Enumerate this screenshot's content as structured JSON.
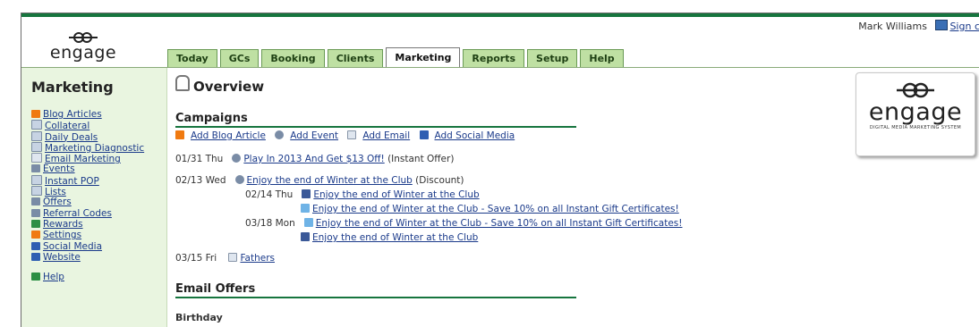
{
  "app": {
    "logo_text": "engage",
    "user_name": "Mark Williams",
    "sign_out": "Sign c"
  },
  "tabs": [
    {
      "label": "Today"
    },
    {
      "label": "GCs"
    },
    {
      "label": "Booking"
    },
    {
      "label": "Clients"
    },
    {
      "label": "Marketing",
      "active": true
    },
    {
      "label": "Reports"
    },
    {
      "label": "Setup"
    },
    {
      "label": "Help"
    }
  ],
  "sidebar": {
    "title": "Marketing",
    "items": [
      {
        "label": "Blog Articles",
        "icon": "rss-icon"
      },
      {
        "label": "Collateral",
        "icon": "collateral-icon"
      },
      {
        "label": "Daily Deals",
        "icon": "daily-deals-icon"
      },
      {
        "label": "Marketing Diagnostic",
        "icon": "diagnostic-icon"
      },
      {
        "label": "Email Marketing",
        "icon": "email-icon"
      },
      {
        "label": "Events",
        "icon": "events-icon"
      },
      {
        "label": "Instant POP",
        "icon": "pop-icon"
      },
      {
        "label": "Lists",
        "icon": "lists-icon"
      },
      {
        "label": "Offers",
        "icon": "offers-icon"
      },
      {
        "label": "Referral Codes",
        "icon": "referral-icon"
      },
      {
        "label": "Rewards",
        "icon": "rewards-icon"
      },
      {
        "label": "Settings",
        "icon": "settings-icon"
      },
      {
        "label": "Social Media",
        "icon": "social-icon"
      },
      {
        "label": "Website",
        "icon": "website-icon"
      }
    ],
    "help": "Help"
  },
  "main": {
    "title": "Overview",
    "campaigns": {
      "heading": "Campaigns",
      "add_links": [
        "Add Blog Article",
        "Add Event",
        "Add Email",
        "Add Social Media"
      ],
      "entries": {
        "e1": {
          "date": "01/31 Thu",
          "link": "Play In 2013 And Get $13 Off!",
          "note": "(Instant Offer)"
        },
        "e2": {
          "date": "02/13 Wed",
          "link": "Enjoy the end of Winter at the Club",
          "note": "(Discount)"
        },
        "s1": {
          "date": "02/14 Thu",
          "link": "Enjoy the end of Winter at the Club"
        },
        "s2": {
          "link": "Enjoy the end of Winter at the Club - Save 10% on all Instant Gift Certificates!"
        },
        "s3": {
          "date": "03/18 Mon",
          "link": "Enjoy the end of Winter at the Club - Save 10% on all Instant Gift Certificates!"
        },
        "s4": {
          "link": "Enjoy the end of Winter at the Club"
        },
        "e3": {
          "date": "03/15 Fri",
          "link": "Fathers"
        }
      }
    },
    "email_offers": {
      "heading": "Email Offers",
      "sub": "Birthday"
    }
  },
  "brand_box": {
    "word": "engage",
    "tagline": "DIGITAL MEDIA MARKETING SYSTEM"
  },
  "colors": {
    "brand_green": "#16753e",
    "tab_green": "#bfe0a3",
    "sidebar_bg": "#e9f5e0",
    "link": "#1a3a8a"
  }
}
